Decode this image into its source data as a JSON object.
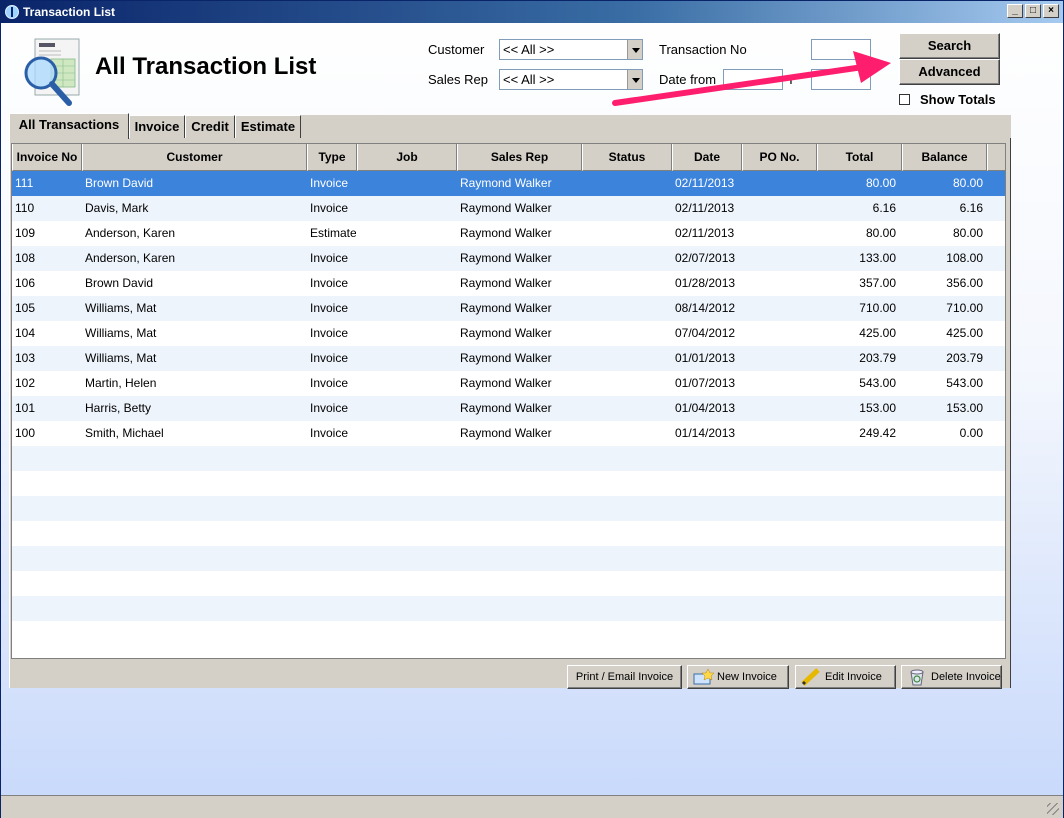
{
  "window": {
    "title": "Transaction List",
    "controls": [
      "_",
      "□",
      "×"
    ]
  },
  "header": {
    "title": "All Transaction List",
    "icon": "invoice-search-icon"
  },
  "filters": {
    "customer_label": "Customer",
    "customer_value": "<< All >>",
    "sales_rep_label": "Sales Rep",
    "sales_rep_value": "<< All >>",
    "transaction_no_label": "Transaction No",
    "date_from_label": "Date from",
    "to_label": "T"
  },
  "actions": {
    "search": "Search",
    "advanced": "Advanced",
    "show_totals": "Show Totals",
    "show_totals_checked": false
  },
  "annotation": {
    "color": "#ff1e6e"
  },
  "tabs": [
    {
      "label": "All Transactions",
      "active": true
    },
    {
      "label": "Invoice",
      "active": false
    },
    {
      "label": "Credit",
      "active": false
    },
    {
      "label": "Estimate",
      "active": false
    }
  ],
  "table": {
    "columns": [
      "Invoice No",
      "Customer",
      "Type",
      "Job",
      "Sales Rep",
      "Status",
      "Date",
      "PO No.",
      "Total",
      "Balance"
    ],
    "rows": [
      [
        "111",
        "Brown David",
        "Invoice",
        "",
        "Raymond Walker",
        "",
        "02/11/2013",
        "",
        "80.00",
        "80.00"
      ],
      [
        "110",
        "Davis, Mark",
        "Invoice",
        "",
        "Raymond Walker",
        "",
        "02/11/2013",
        "",
        "6.16",
        "6.16"
      ],
      [
        "109",
        "Anderson, Karen",
        "Estimate",
        "",
        "Raymond Walker",
        "",
        "02/11/2013",
        "",
        "80.00",
        "80.00"
      ],
      [
        "108",
        "Anderson, Karen",
        "Invoice",
        "",
        "Raymond Walker",
        "",
        "02/07/2013",
        "",
        "133.00",
        "108.00"
      ],
      [
        "106",
        "Brown David",
        "Invoice",
        "",
        "Raymond Walker",
        "",
        "01/28/2013",
        "",
        "357.00",
        "356.00"
      ],
      [
        "105",
        "Williams, Mat",
        "Invoice",
        "",
        "Raymond Walker",
        "",
        "08/14/2012",
        "",
        "710.00",
        "710.00"
      ],
      [
        "104",
        "Williams, Mat",
        "Invoice",
        "",
        "Raymond Walker",
        "",
        "07/04/2012",
        "",
        "425.00",
        "425.00"
      ],
      [
        "103",
        "Williams, Mat",
        "Invoice",
        "",
        "Raymond Walker",
        "",
        "01/01/2013",
        "",
        "203.79",
        "203.79"
      ],
      [
        "102",
        "Martin, Helen",
        "Invoice",
        "",
        "Raymond Walker",
        "",
        "01/07/2013",
        "",
        "543.00",
        "543.00"
      ],
      [
        "101",
        "Harris, Betty",
        "Invoice",
        "",
        "Raymond Walker",
        "",
        "01/04/2013",
        "",
        "153.00",
        "153.00"
      ],
      [
        "100",
        "Smith, Michael",
        "Invoice",
        "",
        "Raymond Walker",
        "",
        "01/14/2013",
        "",
        "249.42",
        "0.00"
      ]
    ],
    "selected_row": 0
  },
  "bottom_buttons": {
    "print_email": "Print / Email Invoice",
    "new_invoice": "New Invoice",
    "edit_invoice": "Edit Invoice",
    "delete_invoice": "Delete Invoice"
  },
  "colors": {
    "selection": "#3c83dc",
    "alt_row": "#eef4fc",
    "title_bar": "#0a246a"
  }
}
